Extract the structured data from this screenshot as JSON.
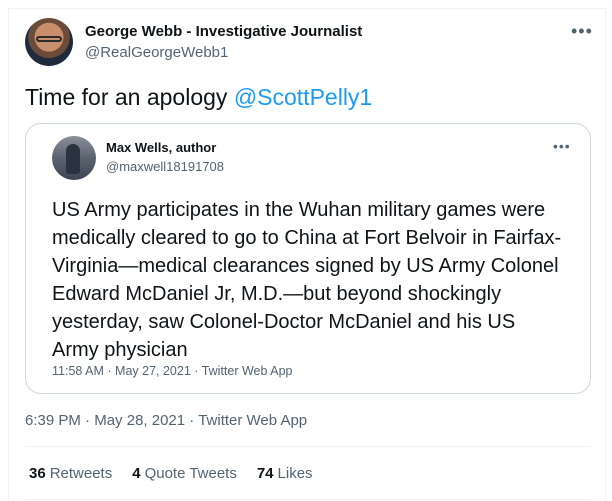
{
  "tweet": {
    "author": {
      "name": "George Webb - Investigative Journalist",
      "handle": "@RealGeorgeWebb1"
    },
    "text": "Time for an apology ",
    "mention": "@ScottPelly1",
    "timestamp": "6:39 PM",
    "date": "May 28, 2021",
    "source": "Twitter Web App",
    "more_icon": "more-horizontal-icon"
  },
  "quote": {
    "author": {
      "name": "Max Wells, author",
      "handle": "@maxwell18191708"
    },
    "lines": [
      "US Army participates in the Wuhan military games were",
      "medically cleared to go to China at Fort Belvoir in Fairfax-",
      "Virginia—medical clearances signed by US Army Colonel",
      "Edward McDaniel Jr, M.D.—but beyond shockingly",
      "yesterday, saw Colonel-Doctor McDaniel and his US",
      "Army physician"
    ],
    "timestamp": "11:58 AM",
    "date": "May 27, 2021",
    "source": "Twitter Web App",
    "separator": "·"
  },
  "stats": [
    {
      "count": "36",
      "label": "Retweets"
    },
    {
      "count": "4",
      "label": "Quote Tweets"
    },
    {
      "count": "74",
      "label": "Likes"
    }
  ],
  "separator": "·",
  "colors": {
    "link": "#1d9bf0",
    "secondary_text": "#536471",
    "border": "#cfd9de"
  }
}
